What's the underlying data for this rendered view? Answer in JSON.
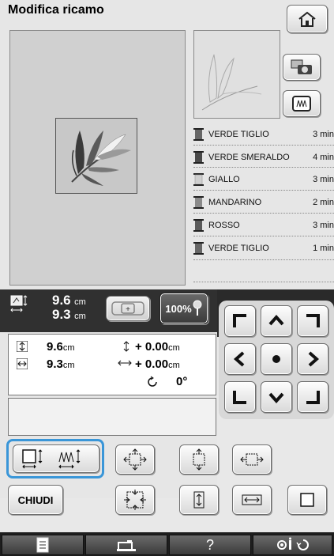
{
  "header": {
    "title": "Modifica ricamo"
  },
  "threads": [
    {
      "name": "VERDE TIGLIO",
      "time": "3 min",
      "color": "#666666"
    },
    {
      "name": "VERDE SMERALDO",
      "time": "4 min",
      "color": "#4a4a4a"
    },
    {
      "name": "GIALLO",
      "time": "3 min",
      "color": "#cfcfcf"
    },
    {
      "name": "MANDARINO",
      "time": "2 min",
      "color": "#8a8a8a"
    },
    {
      "name": "ROSSO",
      "time": "3 min",
      "color": "#5a5a5a"
    },
    {
      "name": "VERDE TIGLIO",
      "time": "1 min",
      "color": "#666666"
    }
  ],
  "size_summary": {
    "width": "9.6",
    "height": "9.3",
    "unit": "cm",
    "zoom": "100%"
  },
  "info": {
    "height_value": "9.6",
    "width_value": "9.3",
    "unit": "cm",
    "offset_v": "+ 0.00",
    "offset_h": "+ 0.00",
    "rotation": "0°"
  },
  "buttons": {
    "close_label": "CHIUDI"
  }
}
